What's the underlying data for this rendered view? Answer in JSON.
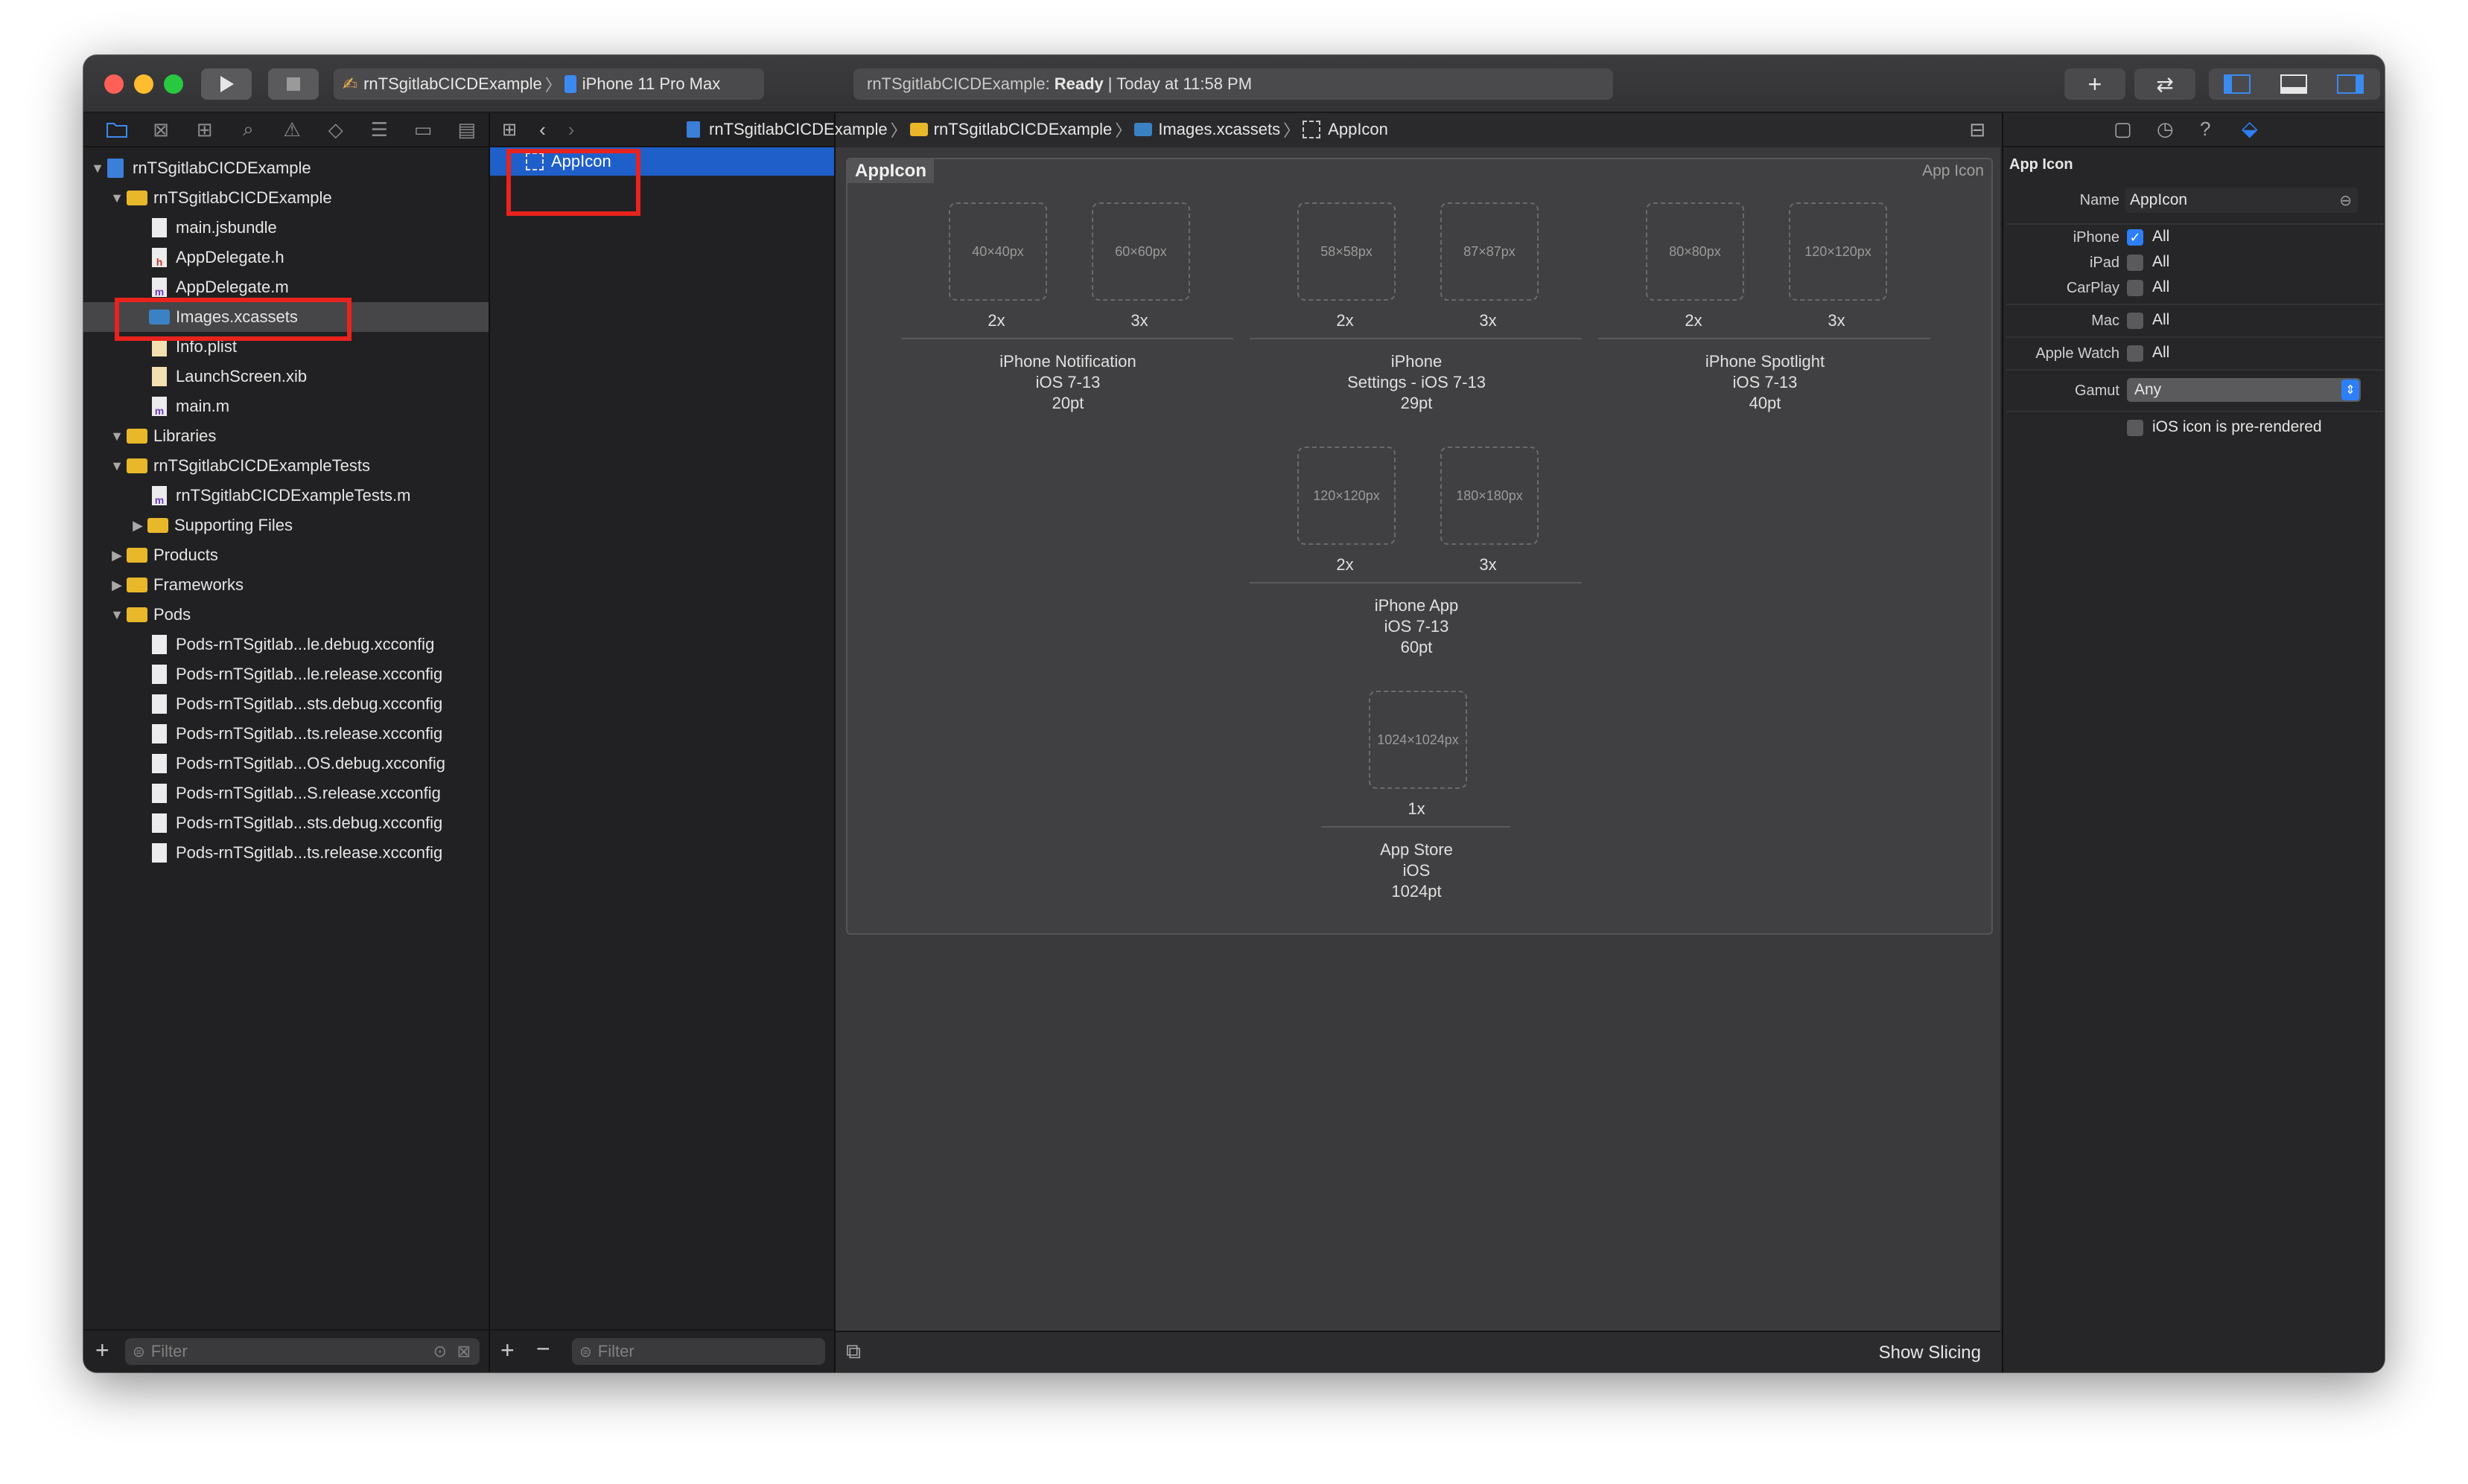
{
  "toolbar": {
    "scheme_project": "rnTSgitlabCICDExample",
    "scheme_separator": "〉",
    "scheme_device": "iPhone 11 Pro Max",
    "status_project": "rnTSgitlabCICDExample:",
    "status_state": "Ready",
    "status_time": "| Today at 11:58 PM"
  },
  "navigator": {
    "items": [
      {
        "label": "rnTSgitlabCICDExample",
        "kind": "project",
        "indent": 0,
        "disclosure": "▼"
      },
      {
        "label": "rnTSgitlabCICDExample",
        "kind": "folder",
        "indent": 1,
        "disclosure": "▼"
      },
      {
        "label": "main.jsbundle",
        "kind": "file",
        "indent": 2,
        "badge": ""
      },
      {
        "label": "AppDelegate.h",
        "kind": "file",
        "indent": 2,
        "badge": "h"
      },
      {
        "label": "AppDelegate.m",
        "kind": "file",
        "indent": 2,
        "badge": "m"
      },
      {
        "label": "Images.xcassets",
        "kind": "bluefolder",
        "indent": 2,
        "selected": true
      },
      {
        "label": "Info.plist",
        "kind": "file",
        "indent": 2,
        "badge": ""
      },
      {
        "label": "LaunchScreen.xib",
        "kind": "file",
        "indent": 2,
        "badge": ""
      },
      {
        "label": "main.m",
        "kind": "file",
        "indent": 2,
        "badge": "m"
      },
      {
        "label": "Libraries",
        "kind": "folder",
        "indent": 1,
        "disclosure": "▼"
      },
      {
        "label": "rnTSgitlabCICDExampleTests",
        "kind": "folder",
        "indent": 1,
        "disclosure": "▼"
      },
      {
        "label": "rnTSgitlabCICDExampleTests.m",
        "kind": "file",
        "indent": 2,
        "badge": "m"
      },
      {
        "label": "Supporting Files",
        "kind": "folder",
        "indent": 2,
        "disclosure": "▶"
      },
      {
        "label": "Products",
        "kind": "folder",
        "indent": 1,
        "disclosure": "▶"
      },
      {
        "label": "Frameworks",
        "kind": "folder",
        "indent": 1,
        "disclosure": "▶"
      },
      {
        "label": "Pods",
        "kind": "folder",
        "indent": 1,
        "disclosure": "▼"
      },
      {
        "label": "Pods-rnTSgitlab...le.debug.xcconfig",
        "kind": "file",
        "indent": 2,
        "badge": ""
      },
      {
        "label": "Pods-rnTSgitlab...le.release.xcconfig",
        "kind": "file",
        "indent": 2,
        "badge": ""
      },
      {
        "label": "Pods-rnTSgitlab...sts.debug.xcconfig",
        "kind": "file",
        "indent": 2,
        "badge": ""
      },
      {
        "label": "Pods-rnTSgitlab...ts.release.xcconfig",
        "kind": "file",
        "indent": 2,
        "badge": ""
      },
      {
        "label": "Pods-rnTSgitlab...OS.debug.xcconfig",
        "kind": "file",
        "indent": 2,
        "badge": ""
      },
      {
        "label": "Pods-rnTSgitlab...S.release.xcconfig",
        "kind": "file",
        "indent": 2,
        "badge": ""
      },
      {
        "label": "Pods-rnTSgitlab...sts.debug.xcconfig",
        "kind": "file",
        "indent": 2,
        "badge": ""
      },
      {
        "label": "Pods-rnTSgitlab...ts.release.xcconfig",
        "kind": "file",
        "indent": 2,
        "badge": ""
      }
    ],
    "filter_placeholder": "Filter"
  },
  "assets": {
    "items": [
      {
        "label": "AppIcon",
        "selected": true
      }
    ],
    "filter_placeholder": "Filter"
  },
  "jumpbar": {
    "crumbs": [
      "rnTSgitlabCICDExample",
      "rnTSgitlabCICDExample",
      "Images.xcassets",
      "AppIcon"
    ],
    "sep": "〉"
  },
  "editor": {
    "set_name": "AppIcon",
    "set_type": "App Icon",
    "groups": [
      {
        "slots": [
          "40×40px",
          "60×60px"
        ],
        "scales": [
          "2x",
          "3x"
        ],
        "caption": [
          "iPhone Notification",
          "iOS 7-13",
          "20pt"
        ]
      },
      {
        "slots": [
          "58×58px",
          "87×87px"
        ],
        "scales": [
          "2x",
          "3x"
        ],
        "caption": [
          "iPhone",
          "Settings - iOS 7-13",
          "29pt"
        ]
      },
      {
        "slots": [
          "80×80px",
          "120×120px"
        ],
        "scales": [
          "2x",
          "3x"
        ],
        "caption": [
          "iPhone Spotlight",
          "iOS 7-13",
          "40pt"
        ]
      },
      {
        "slots": [
          "120×120px",
          "180×180px"
        ],
        "scales": [
          "2x",
          "3x"
        ],
        "caption": [
          "iPhone App",
          "iOS 7-13",
          "60pt"
        ]
      },
      {
        "slots": [
          "1024×1024px"
        ],
        "scales": [
          "1x"
        ],
        "caption": [
          "App Store",
          "iOS",
          "1024pt"
        ]
      }
    ],
    "show_slicing": "Show Slicing"
  },
  "inspector": {
    "section_title": "App Icon",
    "name_label": "Name",
    "name_value": "AppIcon",
    "rows": [
      {
        "label": "iPhone",
        "checked": true,
        "value": "All"
      },
      {
        "label": "iPad",
        "checked": false,
        "value": "All"
      },
      {
        "label": "CarPlay",
        "checked": false,
        "value": "All"
      },
      {
        "label": "Mac",
        "checked": false,
        "value": "All"
      },
      {
        "label": "Apple Watch",
        "checked": false,
        "value": "All"
      }
    ],
    "gamut_label": "Gamut",
    "gamut_value": "Any",
    "prerendered_label": "iOS icon is pre-rendered"
  },
  "colors": {
    "accent": "#2d7ef7",
    "selection": "#1f5fc9",
    "highlight": "#e8231e"
  }
}
